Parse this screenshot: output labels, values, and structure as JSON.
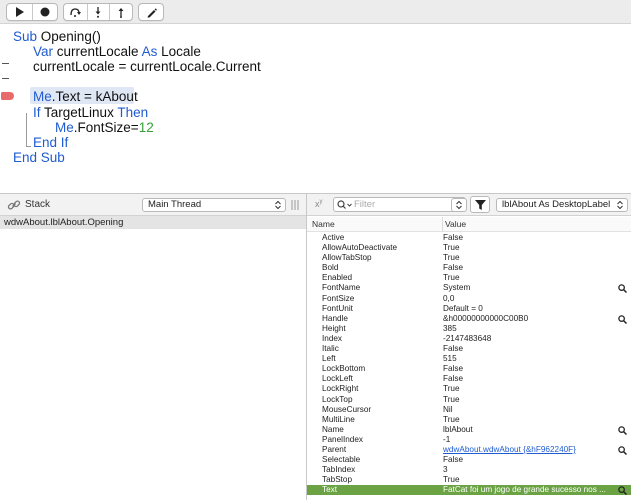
{
  "toolbar": {
    "run_icon": "play-icon",
    "stop_icon": "stop-record-icon",
    "step_over_icon": "step-over-icon",
    "step_into_icon": "step-into-icon",
    "step_out_icon": "step-out-icon",
    "edit_icon": "pencil-icon"
  },
  "code": {
    "line1_kw": "Sub",
    "line1_rest": " Opening()",
    "line2_kw1": "Var",
    "line2_mid": " currentLocale ",
    "line2_kw2": "As",
    "line2_rest": " Locale",
    "line3": "currentLocale = currentLocale.Current",
    "line5_kw": "Me",
    "line5_rest": ".Text = kAbout",
    "line6_kw1": "If",
    "line6_mid": " TargetLinux ",
    "line6_kw2": "Then",
    "line7_kw": "Me",
    "line7_rest": ".FontSize=",
    "line7_num": "12",
    "line8": "End If",
    "line9": "End Sub"
  },
  "stack": {
    "title": "Stack",
    "thread_select": "Main Thread",
    "frames": [
      "wdwAbout.lblAbout.Opening"
    ]
  },
  "variables": {
    "search_placeholder": "Filter",
    "object_select": "lblAbout As DesktopLabel",
    "col_name": "Name",
    "col_value": "Value",
    "rows": [
      {
        "name": "Active",
        "value": "False"
      },
      {
        "name": "AllowAutoDeactivate",
        "value": "True"
      },
      {
        "name": "AllowTabStop",
        "value": "True"
      },
      {
        "name": "Bold",
        "value": "False"
      },
      {
        "name": "Enabled",
        "value": "True"
      },
      {
        "name": "FontName",
        "value": "System"
      },
      {
        "name": "FontSize",
        "value": "0,0"
      },
      {
        "name": "FontUnit",
        "value": "Default = 0"
      },
      {
        "name": "Handle",
        "value": "&h00000000000C00B0"
      },
      {
        "name": "Height",
        "value": "385"
      },
      {
        "name": "Index",
        "value": "-2147483648"
      },
      {
        "name": "Italic",
        "value": "False"
      },
      {
        "name": "Left",
        "value": "515"
      },
      {
        "name": "LockBottom",
        "value": "False"
      },
      {
        "name": "LockLeft",
        "value": "False"
      },
      {
        "name": "LockRight",
        "value": "True"
      },
      {
        "name": "LockTop",
        "value": "True"
      },
      {
        "name": "MouseCursor",
        "value": "Nil"
      },
      {
        "name": "MultiLine",
        "value": "True"
      },
      {
        "name": "Name",
        "value": "lblAbout"
      },
      {
        "name": "PanelIndex",
        "value": "-1"
      },
      {
        "name": "Parent",
        "value": "wdwAbout.wdwAbout {&hF962240F}"
      },
      {
        "name": "Selectable",
        "value": "False"
      },
      {
        "name": "TabIndex",
        "value": "3"
      },
      {
        "name": "TabStop",
        "value": "True"
      },
      {
        "name": "Text",
        "value": "FatCat foi um jogo de grande sucesso nos ..."
      }
    ]
  }
}
